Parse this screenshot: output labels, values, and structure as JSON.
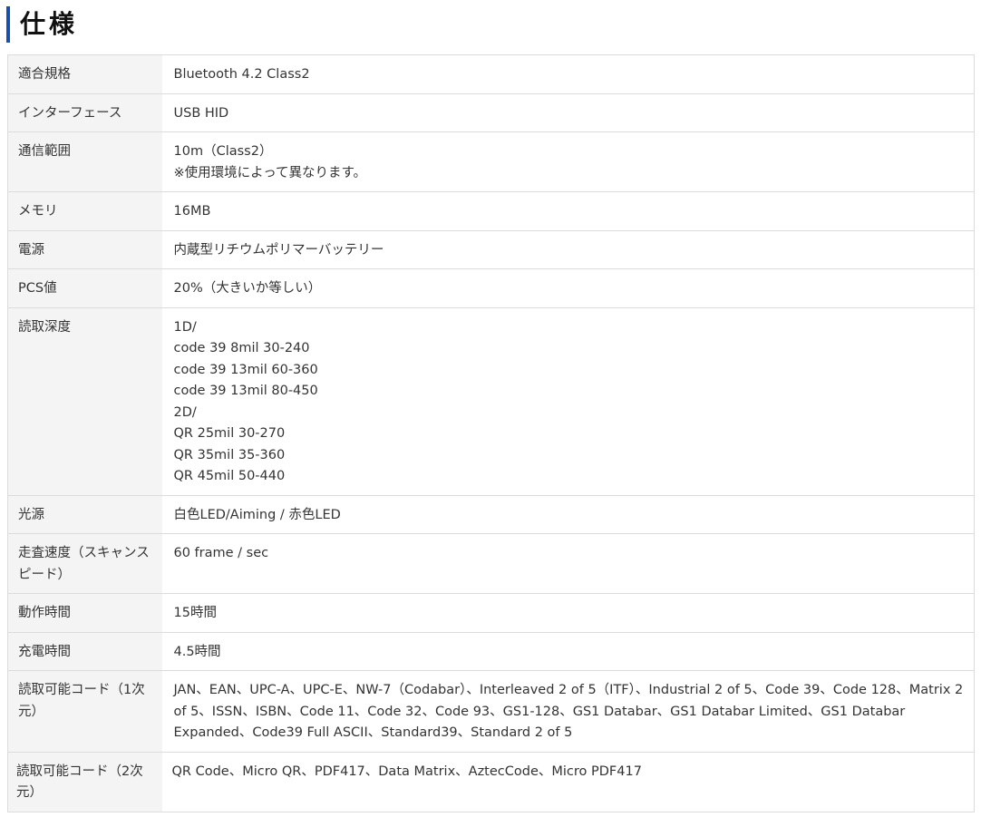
{
  "section": {
    "title": "仕様"
  },
  "specs": [
    {
      "label": "適合規格",
      "value": "Bluetooth 4.2 Class2"
    },
    {
      "label": "インターフェース",
      "value": "USB HID"
    },
    {
      "label": "通信範囲",
      "value": "10m（Class2）\n※使用環境によって異なります。"
    },
    {
      "label": "メモリ",
      "value": "16MB"
    },
    {
      "label": "電源",
      "value": "内蔵型リチウムポリマーバッテリー"
    },
    {
      "label": "PCS値",
      "value": "20%（大きいか等しい）"
    },
    {
      "label": "読取深度",
      "value": "1D/\ncode 39 8mil 30-240\ncode 39 13mil 60-360\ncode 39 13mil 80-450\n2D/\nQR 25mil 30-270\nQR 35mil 35-360\nQR 45mil 50-440"
    },
    {
      "label": "光源",
      "value": "白色LED/Aiming / 赤色LED"
    },
    {
      "label": "走査速度（スキャンスピード）",
      "value": "60 frame / sec"
    },
    {
      "label": "動作時間",
      "value": "15時間"
    },
    {
      "label": "充電時間",
      "value": "4.5時間"
    },
    {
      "label": "読取可能コード（1次元）",
      "value": "JAN、EAN、UPC-A、UPC-E、NW-7（Codabar）、Interleaved 2 of 5（ITF）、Industrial 2 of 5、Code 39、Code 128、Matrix 2 of 5、ISSN、ISBN、Code 11、Code 32、Code 93、GS1-128、GS1 Databar、GS1 Databar Limited、GS1 Databar Expanded、Code39 Full ASCII、Standard39、Standard 2 of 5"
    },
    {
      "label": "読取可能コード（2次元）",
      "value": "QR Code、Micro QR、PDF417、Data Matrix、AztecCode、Micro PDF417"
    }
  ]
}
